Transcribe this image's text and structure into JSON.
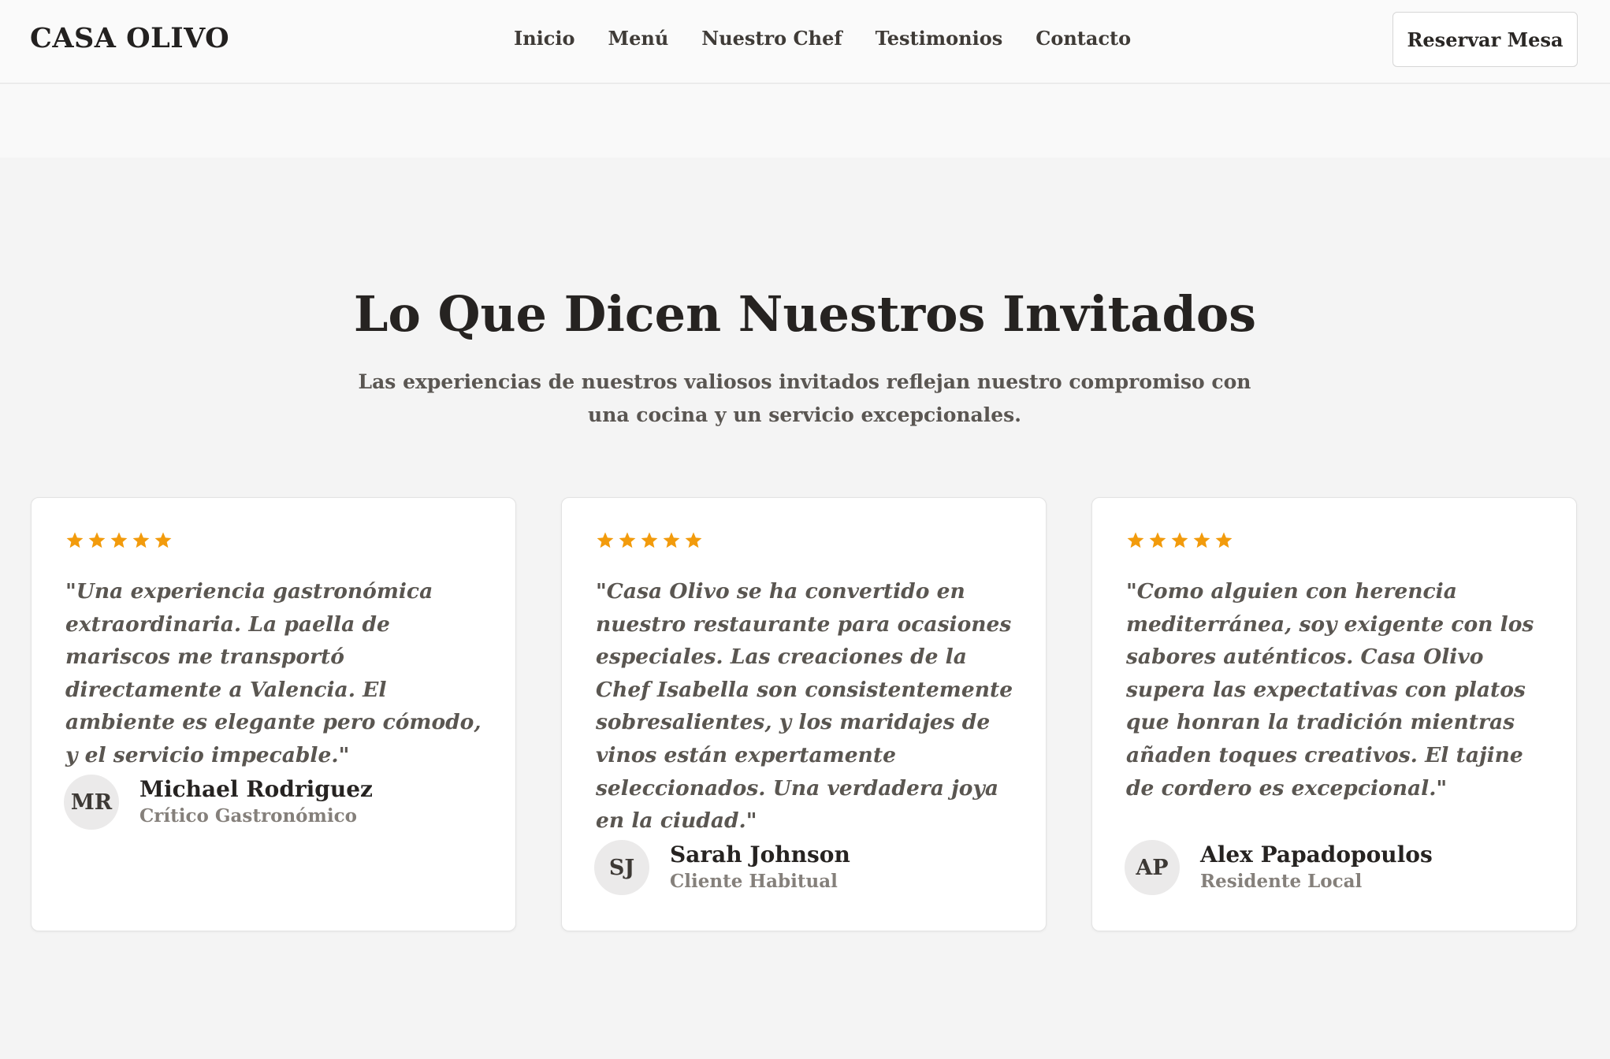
{
  "header": {
    "brand": "CASA OLIVO",
    "nav": [
      "Inicio",
      "Menú",
      "Nuestro Chef",
      "Testimonios",
      "Contacto"
    ],
    "reserve_label": "Reservar Mesa"
  },
  "section": {
    "title": "Lo Que Dicen Nuestros Invitados",
    "subtitle": "Las experiencias de nuestros valiosos invitados reflejan nuestro compromiso con una cocina y un servicio excepcionales."
  },
  "testimonials": [
    {
      "rating": 5,
      "quote": "\"Una experiencia gastronómica extraordinaria. La paella de mariscos me transportó directamente a Valencia. El ambiente es elegante pero cómodo, y el servicio impecable.\"",
      "initials": "MR",
      "name": "Michael Rodriguez",
      "role": "Crítico Gastronómico"
    },
    {
      "rating": 5,
      "quote": "\"Casa Olivo se ha convertido en nuestro restaurante para ocasiones especiales. Las creaciones de la Chef Isabella son consistentemente sobresalientes, y los maridajes de vinos están expertamente seleccionados. Una verdadera joya en la ciudad.\"",
      "initials": "SJ",
      "name": "Sarah Johnson",
      "role": "Cliente Habitual"
    },
    {
      "rating": 5,
      "quote": "\"Como alguien con herencia mediterránea, soy exigente con los sabores auténticos. Casa Olivo supera las expectativas con platos que honran la tradición mientras añaden toques creativos. El tajine de cordero es excepcional.\"",
      "initials": "AP",
      "name": "Alex Papadopoulos",
      "role": "Residente Local"
    }
  ],
  "colors": {
    "star": "#f29b0c",
    "page_background": "#f4f4f4",
    "card_background": "#ffffff",
    "avatar_background": "#ebeaea"
  },
  "icons": {
    "rating": "star-icon"
  }
}
